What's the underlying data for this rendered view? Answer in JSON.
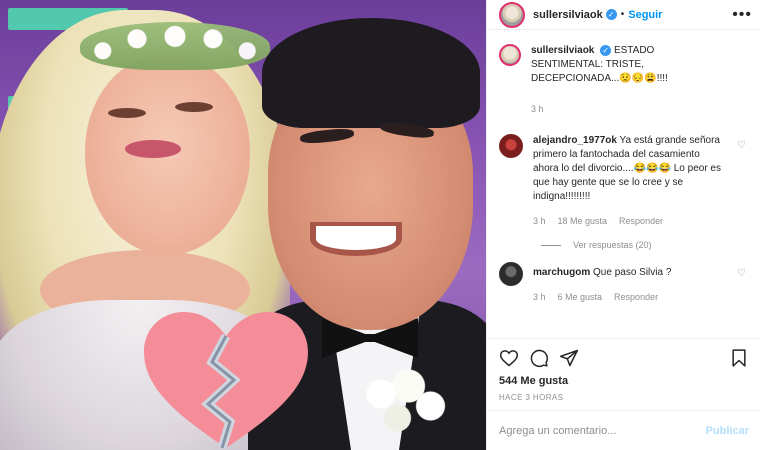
{
  "post": {
    "username": "sullersilviaok",
    "follow_label": "Seguir",
    "separator": "•",
    "more_label": "•••",
    "verified_mark": "✓",
    "caption": {
      "username": "sullersilviaok",
      "text": "ESTADO SENTIMENTAL: TRISTE, DECEPCIONADA...😟😔😩!!!!",
      "time": "3 h"
    },
    "comments": [
      {
        "username": "alejandro_1977ok",
        "text": "Ya está grande señora primero la fantochada del casamiento ahora lo del divorcio....😂😂😂 Lo peor es que hay gente que se lo cree y se indigna!!!!!!!!!",
        "time": "3 h",
        "likes": "18 Me gusta",
        "reply_label": "Responder",
        "view_replies": "Ver respuestas (20)"
      },
      {
        "username": "marchugom",
        "text": "Que paso Silvia ?",
        "time": "3 h",
        "likes": "6 Me gusta",
        "reply_label": "Responder"
      }
    ],
    "likes_count": "544 Me gusta",
    "posted_ago": "HACE 3 HORAS",
    "comment_input": {
      "placeholder": "Agrega un comentario...",
      "submit_label": "Publicar"
    }
  },
  "colors": {
    "accent": "#0095f6",
    "verified": "#3897f0",
    "heart_overlay": "#f48d98",
    "muted": "#8e8e8e"
  },
  "icons": [
    "more-options-icon",
    "verified-badge-icon",
    "like-icon",
    "comment-icon",
    "share-icon",
    "bookmark-icon",
    "broken-heart-icon"
  ]
}
